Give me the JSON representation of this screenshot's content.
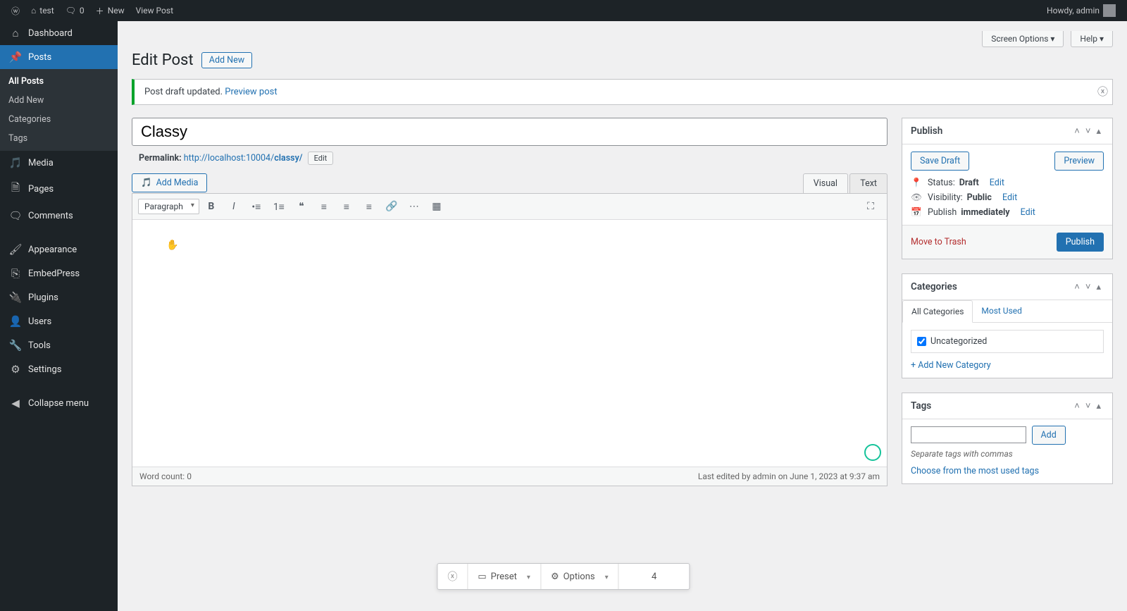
{
  "adminbar": {
    "site_name": "test",
    "comments_count": "0",
    "new_label": "New",
    "view_post": "View Post",
    "howdy": "Howdy, admin"
  },
  "sidebar": {
    "items": [
      {
        "label": "Dashboard",
        "icon": "dashboard"
      },
      {
        "label": "Posts",
        "icon": "pin",
        "current": true
      },
      {
        "label": "Media",
        "icon": "media"
      },
      {
        "label": "Pages",
        "icon": "page"
      },
      {
        "label": "Comments",
        "icon": "comment"
      },
      {
        "label": "Appearance",
        "icon": "appearance"
      },
      {
        "label": "EmbedPress",
        "icon": "embed"
      },
      {
        "label": "Plugins",
        "icon": "plugin"
      },
      {
        "label": "Users",
        "icon": "user"
      },
      {
        "label": "Tools",
        "icon": "tool"
      },
      {
        "label": "Settings",
        "icon": "settings"
      },
      {
        "label": "Collapse menu",
        "icon": "collapse"
      }
    ],
    "posts_submenu": [
      "All Posts",
      "Add New",
      "Categories",
      "Tags"
    ]
  },
  "screen_tabs": {
    "screen_options": "Screen Options",
    "help": "Help"
  },
  "page": {
    "heading": "Edit Post",
    "add_new": "Add New",
    "notice": "Post draft updated.",
    "notice_link": "Preview post",
    "title_value": "Classy",
    "permalink_label": "Permalink:",
    "permalink_base": "http://localhost:10004/",
    "permalink_slug": "classy/",
    "edit_slug": "Edit",
    "add_media": "Add Media",
    "editor_tabs": {
      "visual": "Visual",
      "text": "Text"
    },
    "paragraph": "Paragraph",
    "word_count_label": "Word count: ",
    "word_count": "0",
    "last_edited": "Last edited by admin on June 1, 2023 at 9:37 am"
  },
  "publish": {
    "title": "Publish",
    "save_draft": "Save Draft",
    "preview": "Preview",
    "status_label": "Status: ",
    "status_value": "Draft",
    "status_edit": "Edit",
    "visibility_label": "Visibility: ",
    "visibility_value": "Public",
    "visibility_edit": "Edit",
    "schedule_label": "Publish ",
    "schedule_value": "immediately",
    "schedule_edit": "Edit",
    "trash": "Move to Trash",
    "publish_btn": "Publish"
  },
  "categories": {
    "title": "Categories",
    "tab_all": "All Categories",
    "tab_used": "Most Used",
    "items": [
      "Uncategorized"
    ],
    "add_new": "+ Add New Category"
  },
  "tags": {
    "title": "Tags",
    "add": "Add",
    "hint": "Separate tags with commas",
    "choose": "Choose from the most used tags"
  },
  "floatbar": {
    "preset": "Preset",
    "options": "Options",
    "count": "4"
  }
}
